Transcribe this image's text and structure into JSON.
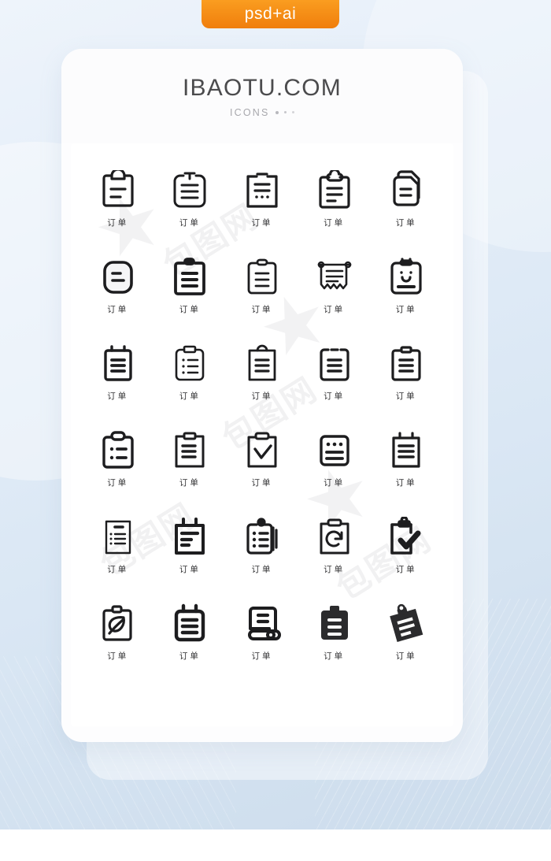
{
  "badge": {
    "text": "psd+ai",
    "color": "#f7941e"
  },
  "card": {
    "title": "IBAOTU.COM",
    "subtitle": "ICONS",
    "subtitle_dots": 3
  },
  "watermarks": [
    "包图网",
    "包图网",
    "包图网",
    "包图网"
  ],
  "palette": {
    "background_top": "#eef4fb",
    "background_bottom": "#ccdcec",
    "card": "#fdfdfe",
    "icon_stroke": "#1d1d1f",
    "title": "#4b4b4d",
    "subtitle": "#a8a8ad"
  },
  "grid": {
    "columns": 5,
    "rows": 6,
    "count": 30,
    "common_label": "订单",
    "icons": [
      {
        "name": "clipboard-two-lines",
        "label": "订单"
      },
      {
        "name": "clipboard-rounded-lines",
        "label": "订单"
      },
      {
        "name": "clipboard-lines-dots",
        "label": "订单"
      },
      {
        "name": "clipboard-cloud-clip-lines",
        "label": "订单"
      },
      {
        "name": "document-stack-lines",
        "label": "订单"
      },
      {
        "name": "note-rounded-single-line",
        "label": "订单"
      },
      {
        "name": "clipboard-bold-three-lines",
        "label": "订单"
      },
      {
        "name": "clipboard-thin-three-lines",
        "label": "订单"
      },
      {
        "name": "receipt-zigzag-lines",
        "label": "订单"
      },
      {
        "name": "clipboard-smiley-face",
        "label": "订单"
      },
      {
        "name": "notepad-rings-lines",
        "label": "订单"
      },
      {
        "name": "clipboard-checklist-dots",
        "label": "订单"
      },
      {
        "name": "clipboard-round-clip-lines",
        "label": "订单"
      },
      {
        "name": "clipboard-dashed-top-lines",
        "label": "订单"
      },
      {
        "name": "clipboard-square-clip-lines",
        "label": "订单"
      },
      {
        "name": "clipboard-pill-clip-list",
        "label": "订单"
      },
      {
        "name": "clipboard-tab-three-lines",
        "label": "订单"
      },
      {
        "name": "clipboard-checkmark",
        "label": "订单"
      },
      {
        "name": "clipboard-three-dots-lines",
        "label": "订单"
      },
      {
        "name": "notepad-two-rings-lines",
        "label": "订单"
      },
      {
        "name": "document-bullet-list",
        "label": "订单"
      },
      {
        "name": "notepad-bold-rings-lines",
        "label": "订单"
      },
      {
        "name": "clipboard-pin-checklist",
        "label": "订单"
      },
      {
        "name": "clipboard-refresh-arrow",
        "label": "订单"
      },
      {
        "name": "clipboard-bold-check",
        "label": "订单"
      },
      {
        "name": "clipboard-leaf",
        "label": "订单"
      },
      {
        "name": "notepad-filled-rings",
        "label": "订单"
      },
      {
        "name": "scroll-document-lines",
        "label": "订单"
      },
      {
        "name": "clipboard-solid-lines",
        "label": "订单"
      },
      {
        "name": "clipboard-tilted-solid",
        "label": "订单"
      }
    ]
  }
}
